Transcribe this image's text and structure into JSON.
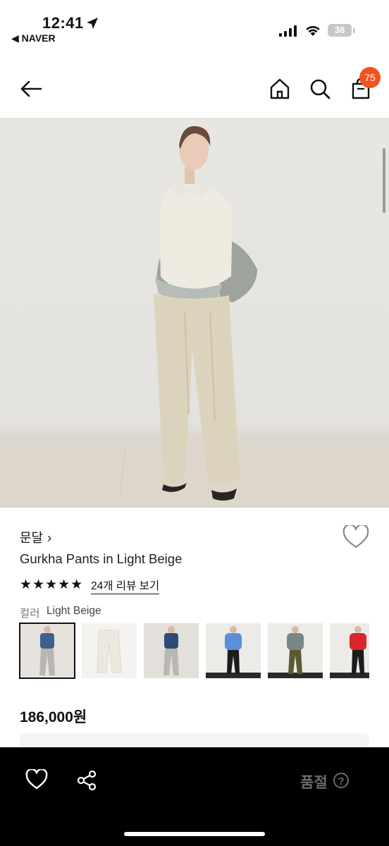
{
  "status_bar": {
    "time": "12:41",
    "back_app": "◀ NAVER",
    "battery": "38"
  },
  "header": {
    "icons": [
      "back-arrow-icon",
      "home-icon",
      "search-icon",
      "shopping-bag-icon"
    ],
    "cart_count": "75",
    "badge_color": "#f2521f"
  },
  "product": {
    "brand": "문달",
    "brand_chevron": "›",
    "name": "Gurkha Pants in Light Beige",
    "rating": 5,
    "stars": "★★★★★",
    "review_link": "24개 리뷰 보기",
    "color_label": "컬러",
    "color_value": "Light Beige",
    "thumbnails": [
      {
        "name": "thumb-blue-knit-grey-pants",
        "top": "#3f5f8f",
        "bottom": "#b8b6b0",
        "bg": "#e6e3de",
        "selected": true
      },
      {
        "name": "thumb-beige-pants-flat",
        "top": null,
        "bottom": "#ece8df",
        "bg": "#f4f3f0",
        "selected": false
      },
      {
        "name": "thumb-navy-knit-grey-pants",
        "top": "#2f4a74",
        "bottom": "#b9b7b2",
        "bg": "#e3e0db",
        "selected": false
      },
      {
        "name": "thumb-blue-sweater-black-pants",
        "top": "#5b8fd8",
        "bottom": "#1c1c1c",
        "bg": "#ecebe8",
        "selected": false
      },
      {
        "name": "thumb-grey-sweater-olive-pants",
        "top": "#7a8586",
        "bottom": "#5b5a35",
        "bg": "#ecebe8",
        "selected": false
      },
      {
        "name": "thumb-red-sweater-black-pants",
        "top": "#d8262c",
        "bottom": "#1c1c1c",
        "bg": "#ecebe8",
        "selected": false
      }
    ],
    "price": "186,000원"
  },
  "bottom_bar": {
    "status": "품절",
    "help": "?"
  }
}
